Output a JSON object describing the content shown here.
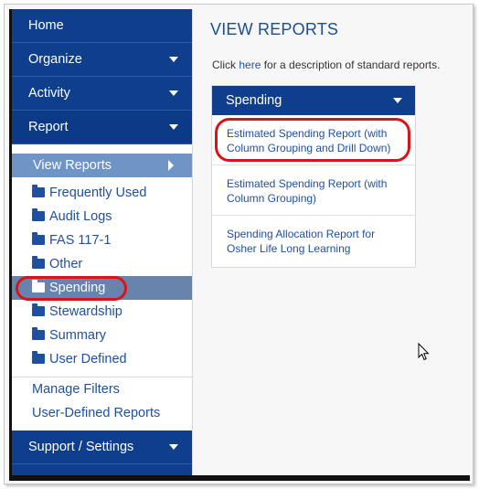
{
  "sidebar": {
    "nav": [
      {
        "label": "Home"
      },
      {
        "label": "Organize"
      },
      {
        "label": "Activity"
      },
      {
        "label": "Report"
      }
    ],
    "view_reports_label": "View Reports",
    "folders": [
      {
        "label": "Frequently Used"
      },
      {
        "label": "Audit Logs"
      },
      {
        "label": "FAS 117-1"
      },
      {
        "label": "Other"
      },
      {
        "label": "Spending"
      },
      {
        "label": "Stewardship"
      },
      {
        "label": "Summary"
      },
      {
        "label": "User Defined"
      }
    ],
    "links": [
      {
        "label": "Manage Filters"
      },
      {
        "label": "User-Defined Reports"
      }
    ],
    "support_label": "Support / Settings"
  },
  "main": {
    "title": "VIEW REPORTS",
    "intro_before": "Click ",
    "intro_link": "here",
    "intro_after": " for a description of standard reports.",
    "panel": {
      "header": "Spending",
      "reports": [
        {
          "line1": "Estimated Spending Report (with",
          "line2": "Column Grouping and Drill Down)"
        },
        {
          "line1": "Estimated Spending Report (with",
          "line2": "Column Grouping)"
        },
        {
          "line1": "Spending Allocation Report for",
          "line2": "Osher Life Long Learning"
        }
      ]
    }
  },
  "colors": {
    "nav_bg": "#0f3e8c",
    "link": "#1f4f9e",
    "selected_bg": "#6884ad",
    "highlight": "#d8141b"
  },
  "icons": [
    "folder-icon",
    "chevron-down-icon",
    "chevron-right-icon",
    "mouse-cursor-icon"
  ]
}
